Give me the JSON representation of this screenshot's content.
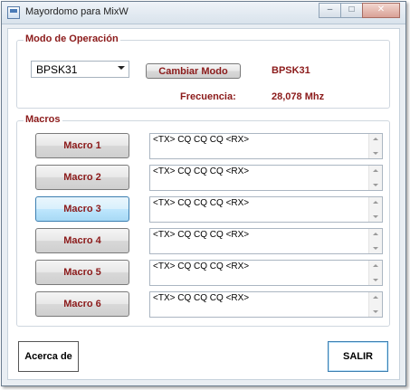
{
  "window": {
    "title": "Mayordomo para MixW"
  },
  "mode_group": {
    "title": "Modo de Operación",
    "mode_select_value": "BPSK31",
    "change_mode_label": "Cambiar Modo",
    "current_mode": "BPSK31",
    "frequency_label": "Frecuencia:",
    "frequency_value": "28,078 Mhz"
  },
  "macros_group": {
    "title": "Macros",
    "items": [
      {
        "label": "Macro 1",
        "text": "<TX> CQ CQ CQ <RX>"
      },
      {
        "label": "Macro 2",
        "text": "<TX> CQ CQ CQ <RX>"
      },
      {
        "label": "Macro 3",
        "text": "<TX> CQ CQ CQ <RX>"
      },
      {
        "label": "Macro 4",
        "text": "<TX> CQ CQ CQ <RX>"
      },
      {
        "label": "Macro 5",
        "text": "<TX> CQ CQ CQ <RX>"
      },
      {
        "label": "Macro 6",
        "text": "<TX> CQ CQ CQ <RX>"
      }
    ]
  },
  "footer": {
    "about_label": "Acerca de",
    "exit_label": "SALIR"
  },
  "icons": {
    "app": "app-window-icon",
    "minimize": "minimize-icon",
    "maximize": "maximize-icon",
    "close": "close-icon",
    "dropdown": "chevron-down-icon",
    "scroll_up": "scroll-up-arrow-icon",
    "scroll_down": "scroll-down-arrow-icon"
  },
  "colors": {
    "label_text": "#8b1a1a",
    "hover_button": "#bee6fd"
  }
}
